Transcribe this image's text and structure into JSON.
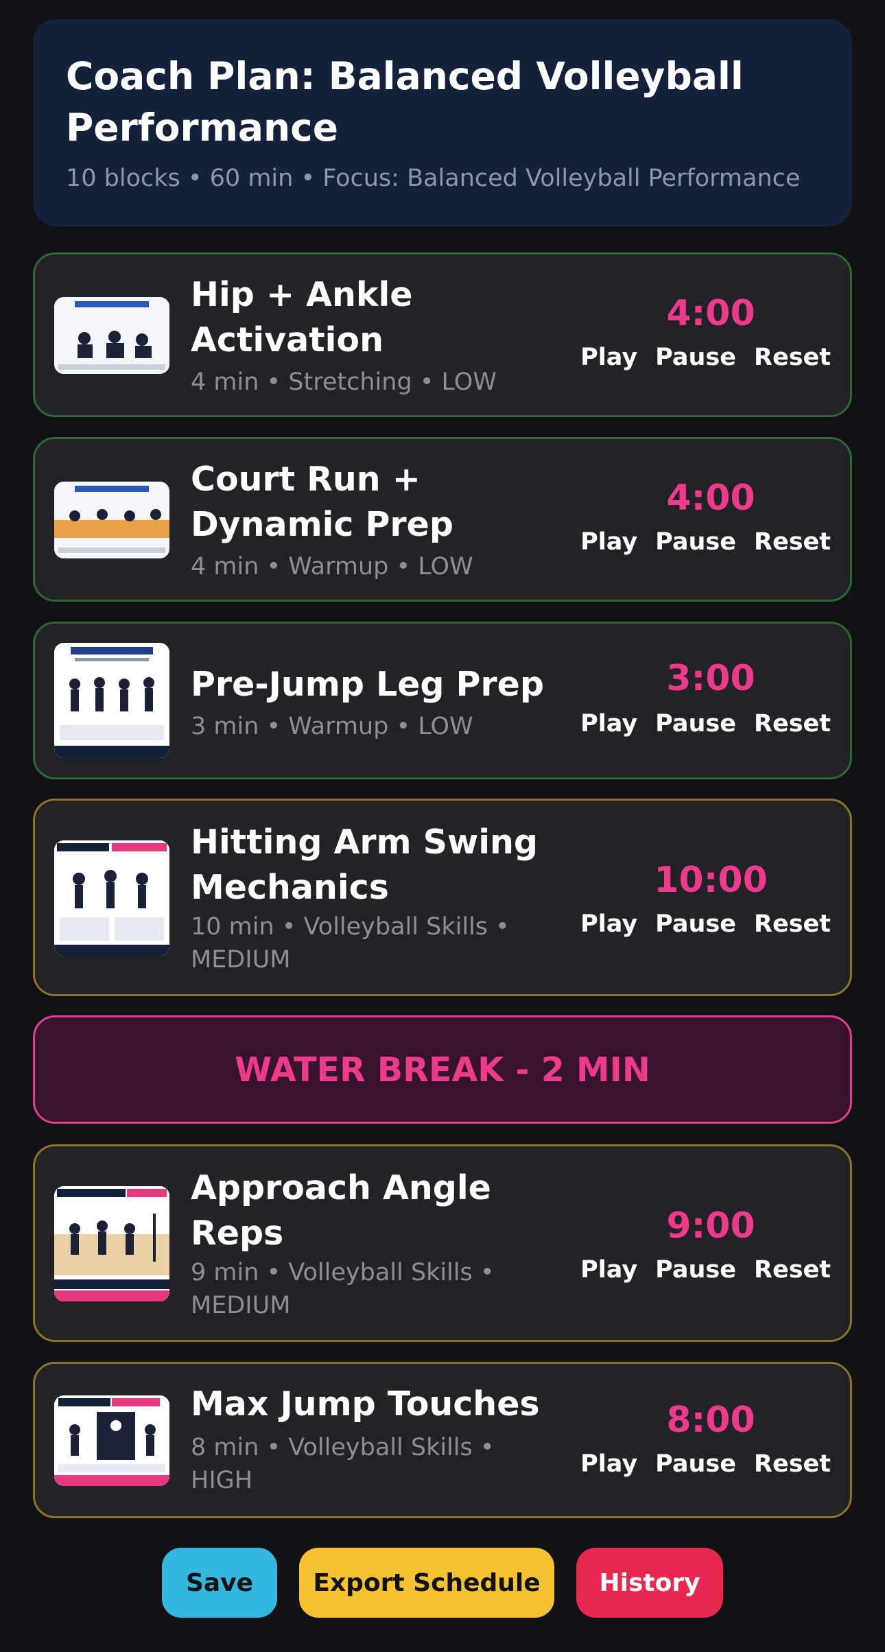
{
  "header": {
    "title": "Coach Plan: Balanced Volleyball Performance",
    "subtitle": "10 blocks • 60 min • Focus: Balanced Volleyball Performance"
  },
  "controls": {
    "play": "Play",
    "pause": "Pause",
    "reset": "Reset"
  },
  "blocks": [
    {
      "title": "Hip + Ankle Activation",
      "meta": "4 min • Stretching • LOW",
      "timer": "4:00",
      "thumb_icon": "stretch-hip-mobility-poster"
    },
    {
      "title": "Court Run + Dynamic Prep",
      "meta": "4 min • Warmup • LOW",
      "timer": "4:00",
      "thumb_icon": "stretch-court-run-poster"
    },
    {
      "title": "Pre-Jump Leg Prep",
      "meta": "3 min • Warmup • LOW",
      "timer": "3:00",
      "thumb_icon": "stretch-pre-jump-poster"
    },
    {
      "title": "Hitting Arm Swing Mechanics",
      "meta": "10 min • Volleyball Skills • MEDIUM",
      "timer": "10:00",
      "thumb_icon": "hitting-arm-swing-mechanics-poster"
    },
    {
      "title": "Approach Angle Reps",
      "meta": "9 min • Volleyball Skills • MEDIUM",
      "timer": "9:00",
      "thumb_icon": "approach-angle-reps-poster"
    },
    {
      "title": "Max Jump Touches",
      "meta": "8 min • Volleyball Skills • HIGH",
      "timer": "8:00",
      "thumb_icon": "max-jump-touches-poster"
    }
  ],
  "water_break": {
    "label": "WATER BREAK - 2 MIN"
  },
  "actions": {
    "save": "Save",
    "export": "Export Schedule",
    "history": "History"
  },
  "colors": {
    "background": "#111116",
    "header_bg": "#13213b",
    "card_bg": "#222227",
    "low_border": "#2a6a33",
    "medium_border": "#8e7424",
    "accent_pink": "#ec3a8c",
    "save_button": "#35b8e0",
    "export_button": "#f5c231",
    "history_button": "#e8294f"
  }
}
